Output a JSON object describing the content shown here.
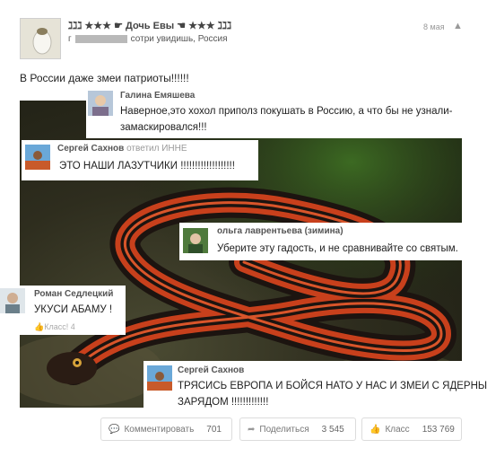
{
  "post": {
    "author": "ℷℷℷ ★★★ ☛ Дочь Евы ☚ ★★★ ℷℷℷ",
    "location_prefix": "г",
    "location_suffix": "сотри увидишь, Россия",
    "date": "8 мая",
    "warn_glyph": "▲",
    "text": "В России даже змеи патриоты!!!!!!"
  },
  "comments": [
    {
      "author": "Галина Емяшева",
      "text_line1": "Наверное,это хохол приполз покушать в Россию, а что бы не узнали-",
      "text_line2": "замаскировался!!!"
    },
    {
      "author": "Сергей Сахнов",
      "reply": "ответил ИННЕ",
      "text": "ЭТО НАШИ ЛАЗУТЧИКИ !!!!!!!!!!!!!!!!!!!"
    },
    {
      "author": "ольга лаврентьева (зимина)",
      "text": "Уберите эту гадость, и не сравнивайте со святым."
    },
    {
      "author": "Роман Седлецкий",
      "text": "УКУСИ АБАМУ !",
      "likes": "Класс! 4"
    },
    {
      "author": "Сергей Сахнов",
      "text_line1": "ТРЯСИСЬ ЕВРОПА И БОЙСЯ НАТО У НАС И ЗМЕИ С ЯДЕРНЫМ",
      "text_line2": "ЗАРЯДОМ !!!!!!!!!!!!!"
    }
  ],
  "actions": {
    "comment_label": "Комментировать",
    "comment_count": "701",
    "share_label": "Поделиться",
    "share_count": "3 545",
    "like_label": "Класс",
    "like_count": "153 769"
  },
  "colors": {
    "snake_red": "#c8401c",
    "snake_dark": "#1c1410"
  }
}
